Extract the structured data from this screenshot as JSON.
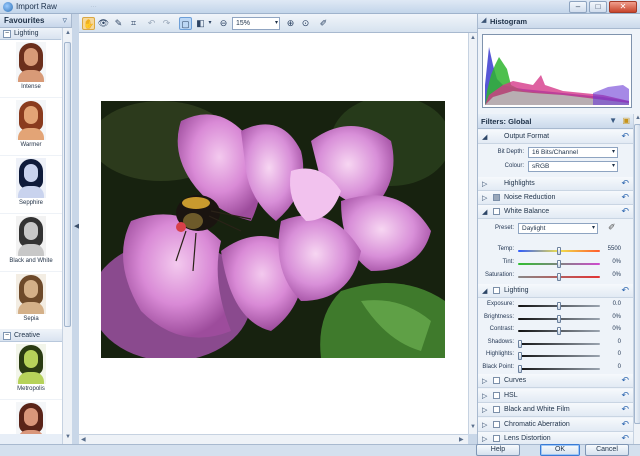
{
  "window": {
    "title": "Import Raw",
    "ghost_title": "…"
  },
  "favourites": {
    "title": "Favourites",
    "categories": [
      {
        "label": "Lighting",
        "toggle": "−"
      },
      {
        "label": "Creative",
        "toggle": "−"
      }
    ],
    "presets": [
      {
        "label": "Intense",
        "hair": "#6b2f1c",
        "face": "#d89a77",
        "bg": "#f4f6f8"
      },
      {
        "label": "Warmer",
        "hair": "#8a3b1e",
        "face": "#e3a476",
        "bg": "#f4f6f8"
      },
      {
        "label": "Sepphire",
        "hair": "#0f1b3a",
        "face": "#c9d3ee",
        "bg": "#eef1f8"
      },
      {
        "label": "Black and White",
        "hair": "#333333",
        "face": "#c8c8c8",
        "bg": "#f2f2f2"
      },
      {
        "label": "Sepia",
        "hair": "#6e4a2a",
        "face": "#d4b088",
        "bg": "#f3ede3"
      },
      {
        "label": "Metropolis",
        "hair": "#2a3b12",
        "face": "#b6d25a",
        "bg": "#f2f5ea"
      },
      {
        "label": "",
        "hair": "#5a2418",
        "face": "#d9967a",
        "bg": "#f4f6f8"
      }
    ]
  },
  "toolbar": {
    "zoom": "15%"
  },
  "histogram": {
    "title": "Histogram"
  },
  "filters": {
    "title": "Filters: Global",
    "output_format": {
      "label": "Output Format",
      "bit_depth_label": "Bit Depth:",
      "bit_depth": "16 Bits/Channel",
      "colour_label": "Colour:",
      "colour": "sRGB"
    },
    "highlights": "Highlights",
    "noise_reduction": "Noise Reduction",
    "white_balance": {
      "label": "White Balance",
      "preset_label": "Preset:",
      "preset": "Daylight",
      "temp_label": "Temp:",
      "temp": "5500",
      "tint_label": "Tint:",
      "tint": "0%",
      "saturation_label": "Saturation:",
      "saturation": "0%"
    },
    "lighting": {
      "label": "Lighting",
      "rows": [
        {
          "label": "Exposure:",
          "value": "0.0"
        },
        {
          "label": "Brightness:",
          "value": "0%"
        },
        {
          "label": "Contrast:",
          "value": "0%"
        },
        {
          "label": "Shadows:",
          "value": "0"
        },
        {
          "label": "Highlights:",
          "value": "0"
        },
        {
          "label": "Black Point:",
          "value": "0"
        }
      ]
    },
    "more": [
      "Curves",
      "HSL",
      "Black and White Film",
      "Chromatic Aberration",
      "Lens Distortion"
    ]
  },
  "buttons": {
    "help": "Help",
    "ok": "OK",
    "cancel": "Cancel"
  }
}
